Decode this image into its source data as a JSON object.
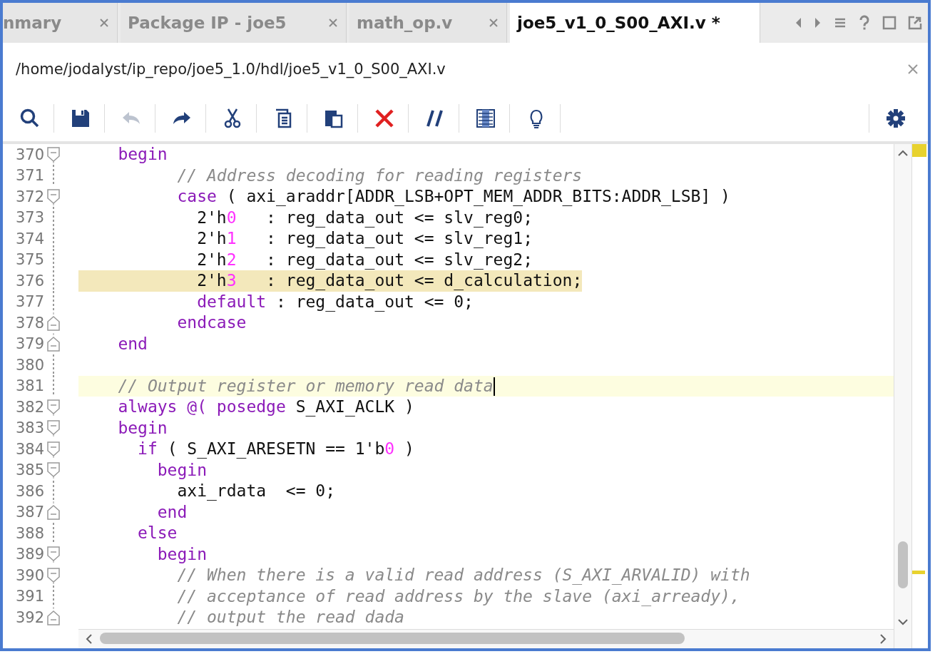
{
  "tabs": [
    {
      "label": "nmary",
      "selected": false
    },
    {
      "label": "Package IP - joe5",
      "selected": false
    },
    {
      "label": "math_op.v",
      "selected": false
    },
    {
      "label": "joe5_v1_0_S00_AXI.v *",
      "selected": true
    }
  ],
  "file_path": "/home/jodalyst/ip_repo/joe5_1.0/hdl/joe5_v1_0_S00_AXI.v",
  "toolbar": [
    {
      "kind": "search",
      "disabled": false
    },
    {
      "kind": "save",
      "disabled": false
    },
    {
      "kind": "undo",
      "disabled": true
    },
    {
      "kind": "redo",
      "disabled": false
    },
    {
      "kind": "cut",
      "disabled": false
    },
    {
      "kind": "copy",
      "disabled": false
    },
    {
      "kind": "paste",
      "disabled": false
    },
    {
      "kind": "delete",
      "disabled": false
    },
    {
      "kind": "comment",
      "disabled": false
    },
    {
      "kind": "columns",
      "disabled": false
    },
    {
      "kind": "hint",
      "disabled": false
    }
  ],
  "lines": [
    {
      "number": "370",
      "kind": "fold-start",
      "highlighted": false,
      "caret": false,
      "tokens": [
        {
          "kind": "keyword",
          "s": "    begin"
        }
      ]
    },
    {
      "number": "371",
      "kind": "plain",
      "highlighted": false,
      "caret": false,
      "tokens": [
        {
          "kind": "comment",
          "s": "          // Address decoding for reading registers"
        }
      ]
    },
    {
      "number": "372",
      "kind": "fold-start",
      "highlighted": false,
      "caret": false,
      "tokens": [
        {
          "kind": "keyword",
          "s": "          case"
        },
        {
          "kind": "plain",
          "s": " ( axi_araddr[ADDR_LSB+OPT_MEM_ADDR_BITS:ADDR_LSB] )"
        }
      ]
    },
    {
      "number": "373",
      "kind": "plain",
      "highlighted": false,
      "caret": false,
      "tokens": [
        {
          "kind": "plain",
          "s": "            2'h"
        },
        {
          "kind": "number",
          "s": "0"
        },
        {
          "kind": "plain",
          "s": "   : reg_data_out <= slv_reg0;"
        }
      ]
    },
    {
      "number": "374",
      "kind": "plain",
      "highlighted": false,
      "caret": false,
      "tokens": [
        {
          "kind": "plain",
          "s": "            2'h"
        },
        {
          "kind": "number",
          "s": "1"
        },
        {
          "kind": "plain",
          "s": "   : reg_data_out <= slv_reg1;"
        }
      ]
    },
    {
      "number": "375",
      "kind": "plain",
      "highlighted": false,
      "caret": false,
      "tokens": [
        {
          "kind": "plain",
          "s": "            2'h"
        },
        {
          "kind": "number",
          "s": "2"
        },
        {
          "kind": "plain",
          "s": "   : reg_data_out <= slv_reg2;"
        }
      ]
    },
    {
      "number": "376",
      "kind": "plain",
      "highlighted": true,
      "caret": false,
      "tokens": [
        {
          "kind": "plain",
          "s": "            2'h"
        },
        {
          "kind": "number",
          "s": "3"
        },
        {
          "kind": "plain",
          "s": "   : reg_data_out <= d_calculation;"
        }
      ]
    },
    {
      "number": "377",
      "kind": "plain",
      "highlighted": false,
      "caret": false,
      "tokens": [
        {
          "kind": "keyword",
          "s": "            default"
        },
        {
          "kind": "plain",
          "s": " : reg_data_out <= 0;"
        }
      ]
    },
    {
      "number": "378",
      "kind": "fold-end",
      "highlighted": false,
      "caret": false,
      "tokens": [
        {
          "kind": "keyword",
          "s": "          endcase"
        }
      ]
    },
    {
      "number": "379",
      "kind": "fold-end",
      "highlighted": false,
      "caret": false,
      "tokens": [
        {
          "kind": "keyword",
          "s": "    end"
        }
      ]
    },
    {
      "number": "380",
      "kind": "plain",
      "highlighted": false,
      "caret": false
    },
    {
      "number": "381",
      "kind": "plain",
      "highlighted": false,
      "caret": true,
      "tokens": [
        {
          "kind": "comment",
          "s": "    // Output register or memory read data"
        }
      ]
    },
    {
      "number": "382",
      "kind": "fold-start",
      "highlighted": false,
      "caret": false,
      "tokens": [
        {
          "kind": "keyword",
          "s": "    always @( posedge"
        },
        {
          "kind": "plain",
          "s": " S_AXI_ACLK )"
        }
      ]
    },
    {
      "number": "383",
      "kind": "fold-start",
      "highlighted": false,
      "caret": false,
      "tokens": [
        {
          "kind": "keyword",
          "s": "    begin"
        }
      ]
    },
    {
      "number": "384",
      "kind": "fold-start",
      "highlighted": false,
      "caret": false,
      "tokens": [
        {
          "kind": "keyword",
          "s": "      if"
        },
        {
          "kind": "plain",
          "s": " ( S_AXI_ARESETN == 1'b"
        },
        {
          "kind": "number",
          "s": "0"
        },
        {
          "kind": "plain",
          "s": " )"
        }
      ]
    },
    {
      "number": "385",
      "kind": "fold-start",
      "highlighted": false,
      "caret": false,
      "tokens": [
        {
          "kind": "keyword",
          "s": "        begin"
        }
      ]
    },
    {
      "number": "386",
      "kind": "plain",
      "highlighted": false,
      "caret": false,
      "tokens": [
        {
          "kind": "plain",
          "s": "          axi_rdata  <= 0;"
        }
      ]
    },
    {
      "number": "387",
      "kind": "fold-end",
      "highlighted": false,
      "caret": false,
      "tokens": [
        {
          "kind": "keyword",
          "s": "        end"
        }
      ]
    },
    {
      "number": "388",
      "kind": "plain",
      "highlighted": false,
      "caret": false,
      "tokens": [
        {
          "kind": "keyword",
          "s": "      else"
        }
      ]
    },
    {
      "number": "389",
      "kind": "fold-start",
      "highlighted": false,
      "caret": false,
      "tokens": [
        {
          "kind": "keyword",
          "s": "        begin"
        }
      ]
    },
    {
      "number": "390",
      "kind": "fold-start",
      "highlighted": false,
      "caret": false,
      "tokens": [
        {
          "kind": "comment",
          "s": "          // When there is a valid read address (S_AXI_ARVALID) with"
        }
      ]
    },
    {
      "number": "391",
      "kind": "plain",
      "highlighted": false,
      "caret": false,
      "tokens": [
        {
          "kind": "comment",
          "s": "          // acceptance of read address by the slave (axi_arready),"
        }
      ]
    },
    {
      "number": "392",
      "kind": "fold-end",
      "highlighted": false,
      "caret": false,
      "tokens": [
        {
          "kind": "comment",
          "s": "          // output the read dada"
        }
      ]
    }
  ]
}
